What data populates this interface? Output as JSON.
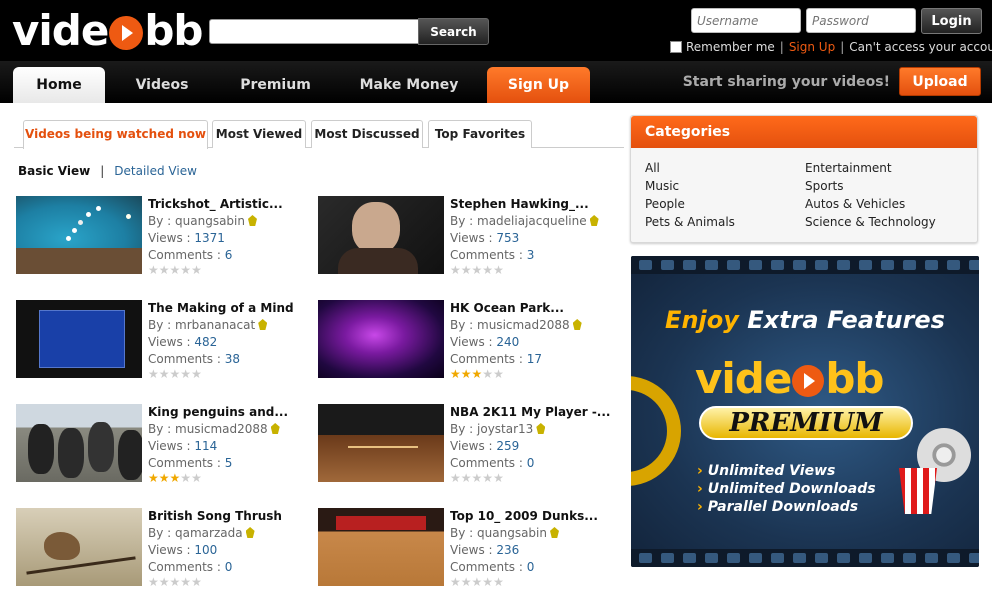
{
  "brand": {
    "logo_pre": "vide",
    "logo_post": "bb"
  },
  "search": {
    "placeholder": "",
    "button_label": "Search"
  },
  "login": {
    "username_placeholder": "Username",
    "password_placeholder": "Password",
    "button_label": "Login",
    "remember_label": "Remember me",
    "signup_link": "Sign Up",
    "forgot_link": "Can't access your account?"
  },
  "nav": {
    "tabs": [
      {
        "label": "Home"
      },
      {
        "label": "Videos"
      },
      {
        "label": "Premium"
      },
      {
        "label": "Make Money"
      },
      {
        "label": "Sign Up"
      }
    ],
    "tagline": "Start sharing your videos!",
    "upload_label": "Upload"
  },
  "subtabs": [
    {
      "label": "Videos being watched now",
      "active": true
    },
    {
      "label": "Most Viewed"
    },
    {
      "label": "Most Discussed"
    },
    {
      "label": "Top Favorites"
    }
  ],
  "view_mode": {
    "basic": "Basic View",
    "separator": "|",
    "detailed": "Detailed View"
  },
  "labels": {
    "by": "By : ",
    "views": "Views : ",
    "comments": "Comments : "
  },
  "videos": [
    {
      "title": "Trickshot_ Artistic...",
      "author": "quangsabin",
      "views": "1371",
      "comments": "6",
      "rating": 0
    },
    {
      "title": "Stephen Hawking_...",
      "author": "madeliajacqueline",
      "views": "753",
      "comments": "3",
      "rating": 0
    },
    {
      "title": "The Making of a Mind",
      "author": "mrbananacat",
      "views": "482",
      "comments": "38",
      "rating": 0
    },
    {
      "title": "HK Ocean Park...",
      "author": "musicmad2088",
      "views": "240",
      "comments": "17",
      "rating": 2.5
    },
    {
      "title": "King penguins and...",
      "author": "musicmad2088",
      "views": "114",
      "comments": "5",
      "rating": 2.5
    },
    {
      "title": "NBA 2K11 My Player -...",
      "author": "joystar13",
      "views": "259",
      "comments": "0",
      "rating": 0
    },
    {
      "title": "British Song Thrush",
      "author": "qamarzada",
      "views": "100",
      "comments": "0",
      "rating": 0
    },
    {
      "title": "Top 10_ 2009 Dunks...",
      "author": "quangsabin",
      "views": "236",
      "comments": "0",
      "rating": 0
    }
  ],
  "categories": {
    "title": "Categories",
    "left": [
      "All",
      "Music",
      "People",
      "Pets & Animals"
    ],
    "right": [
      "Entertainment",
      "Sports",
      "Autos & Vehicles",
      "Science & Technology"
    ]
  },
  "promo": {
    "enjoy": "Enjoy",
    "extra": "Extra Features",
    "logo_pre": "vide",
    "logo_post": "bb",
    "premium": "PREMIUM",
    "features": [
      "Unlimited Views",
      "Unlimited Downloads",
      "Parallel Downloads"
    ]
  },
  "colors": {
    "accent": "#e4500e",
    "link": "#2a6496",
    "header_bg": "#000000"
  }
}
